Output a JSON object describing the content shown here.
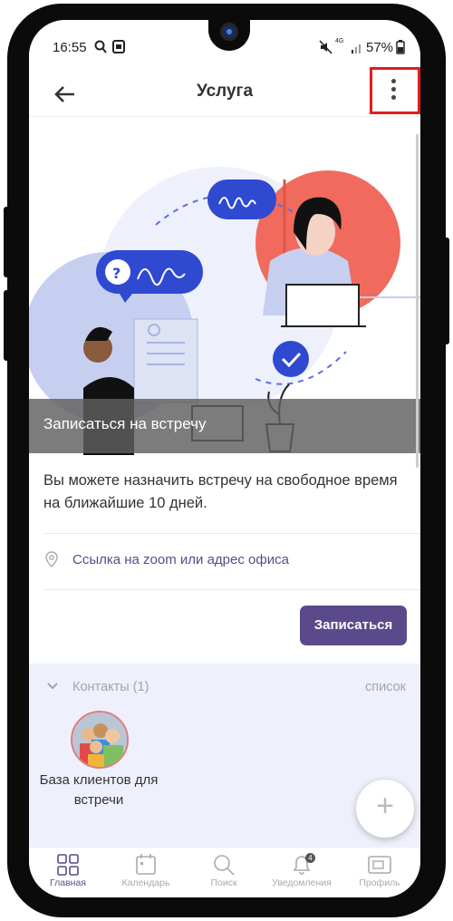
{
  "status_bar": {
    "time": "16:55",
    "network": "4G",
    "battery": "57%"
  },
  "app_bar": {
    "title": "Услуга"
  },
  "hero": {
    "caption": "Записаться на встречу"
  },
  "service": {
    "description": "Вы можете назначить встречу на свободное время на ближайшие 10 дней.",
    "location_link": "Ссылка на zoom или адрес офиса",
    "book_button": "Записаться"
  },
  "contacts": {
    "header": "Контакты (1)",
    "view_mode": "список",
    "items": [
      {
        "name": "База клиентов для встречи"
      }
    ]
  },
  "fab": {
    "label": "+"
  },
  "bottom_nav": {
    "items": [
      {
        "label": "Главная",
        "icon": "grid-icon",
        "active": true
      },
      {
        "label": "Календарь",
        "icon": "calendar-icon"
      },
      {
        "label": "Поиск",
        "icon": "search-icon"
      },
      {
        "label": "Уведомления",
        "icon": "bell-icon",
        "badge": "4"
      },
      {
        "label": "Профиль",
        "icon": "profile-card-icon"
      }
    ]
  },
  "colors": {
    "accent": "#5b4a8b",
    "highlight_box": "#e21d1d",
    "contacts_bg": "#eef1fb"
  }
}
